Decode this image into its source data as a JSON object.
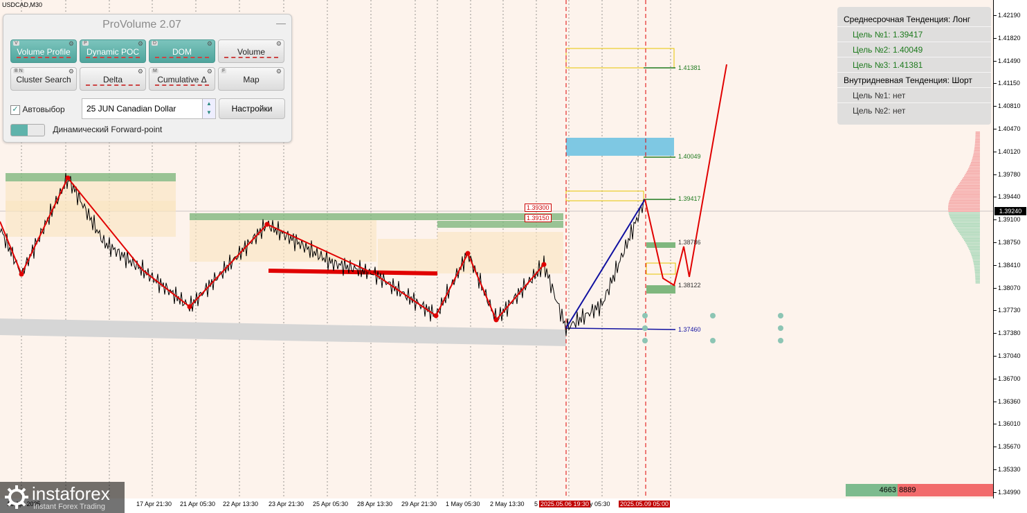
{
  "symbol": "USDCAD,M30",
  "panel": {
    "title": "ProVolume 2.07",
    "buttons": [
      {
        "key": "V",
        "label": "Volume Profile",
        "on": true
      },
      {
        "key": "P",
        "label": "Dynamic POC",
        "on": true
      },
      {
        "key": "D",
        "label": "DOM",
        "on": true
      },
      {
        "key": "",
        "label": "Volume",
        "on": false
      },
      {
        "key": "B N",
        "label": "Cluster Search",
        "on": false
      },
      {
        "key": "",
        "label": "Delta",
        "on": false
      },
      {
        "key": "M",
        "label": "Cumulative Δ",
        "on": false
      },
      {
        "key": "F",
        "label": "Map",
        "on": false
      }
    ],
    "auto_label": "Автовыбор",
    "instrument": "25 JUN Canadian Dollar",
    "settings_label": "Настройки",
    "forward_label": "Динамический Forward-point"
  },
  "trend": {
    "medium_title": "Среднесрочная Тенденция: Лонг",
    "medium_targets": [
      "Цель №1: 1.39417",
      "Цель №2: 1.40049",
      "Цель №3: 1.41381"
    ],
    "intraday_title": "Внутридневная Тенденция: Шорт",
    "intraday_targets": [
      "Цель №1: нет",
      "Цель №2: нет"
    ]
  },
  "price_axis": [
    "1.42190",
    "1.41820",
    "1.41490",
    "1.41150",
    "1.40810",
    "1.40470",
    "1.40120",
    "1.39780",
    "1.39440",
    "1.39100",
    "1.38750",
    "1.38410",
    "1.38070",
    "1.37730",
    "1.37380",
    "1.37040",
    "1.36700",
    "1.36360",
    "1.36010",
    "1.35670",
    "1.35330",
    "1.34990"
  ],
  "current_price": "1.39240",
  "time_axis": [
    "16 Apr 2025",
    "17 Apr 21:30",
    "21 Apr 05:30",
    "22 Apr 13:30",
    "23 Apr 21:30",
    "25 Apr 05:30",
    "28 Apr 13:30",
    "29 Apr 21:30",
    "1 May 05:30",
    "2 May 13:30",
    "5",
    "2025.05.06 19:30",
    "y 05:30",
    "2025.05.09 05:00"
  ],
  "levels": {
    "l1": "1.41381",
    "l2": "1.40049",
    "l3": "1.39417",
    "l4": "1.38786",
    "l5": "1.38122",
    "l6": "1.37460",
    "box1": "1.39300",
    "box2": "1.39150"
  },
  "volume": {
    "buy": "4663",
    "sell": "8889"
  },
  "watermark": {
    "name": "instaforex",
    "sub": "Instant Forex Trading"
  },
  "colors": {
    "chart_bg": "#fdf3ec",
    "zigzag": "#e00000",
    "blue_trend": "#1010a0",
    "green_zone": "#7fb77e",
    "blue_zone": "#7ec8e3",
    "buy": "#7dbb8e",
    "sell": "#f26b6b"
  }
}
